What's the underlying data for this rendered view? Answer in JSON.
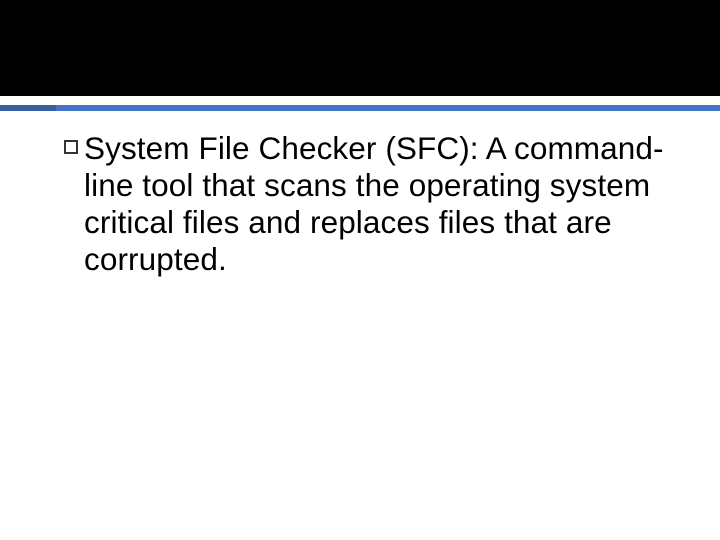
{
  "slide": {
    "bullets": [
      {
        "text": "System File Checker (SFC): A command-line tool that scans the operating  system critical files and replaces files that are corrupted."
      }
    ]
  },
  "colors": {
    "accent": "#4472c4",
    "top_bar": "#000000",
    "text": "#000000"
  }
}
